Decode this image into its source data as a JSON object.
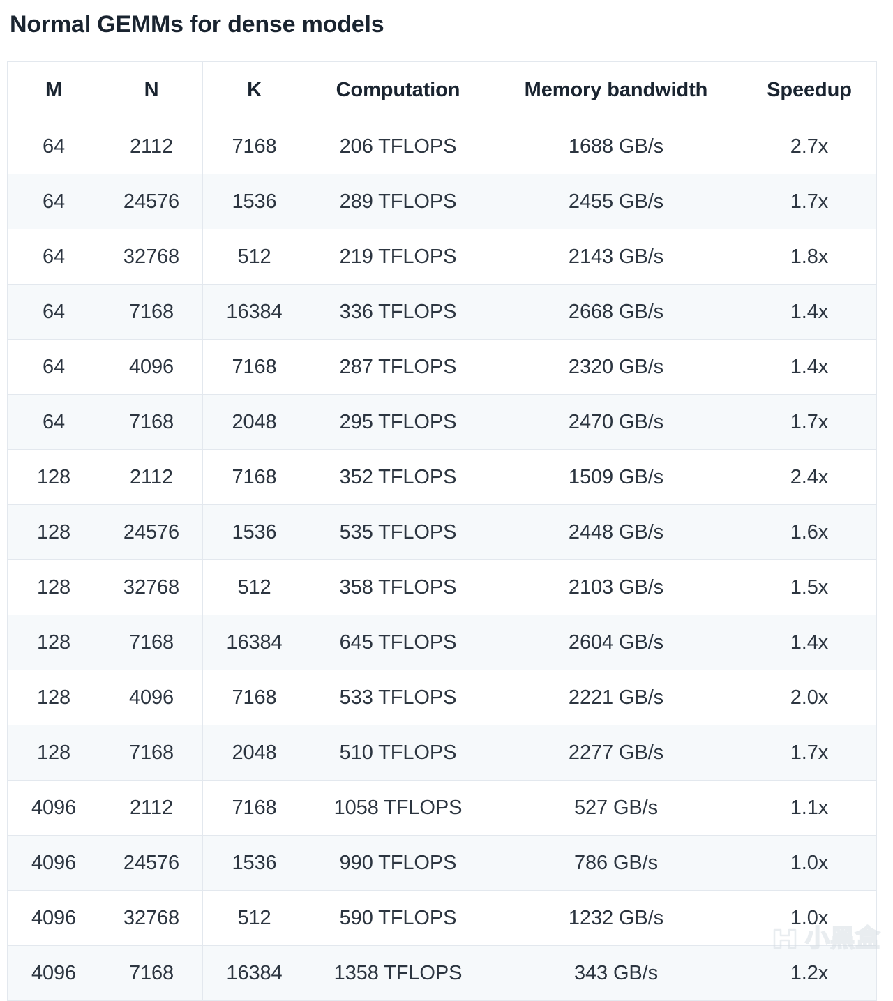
{
  "page": {
    "title": "Normal GEMMs for dense models"
  },
  "table": {
    "columns": [
      {
        "key": "m",
        "label": "M"
      },
      {
        "key": "n",
        "label": "N"
      },
      {
        "key": "k",
        "label": "K"
      },
      {
        "key": "comp",
        "label": "Computation"
      },
      {
        "key": "mem",
        "label": "Memory bandwidth"
      },
      {
        "key": "speedup",
        "label": "Speedup"
      }
    ],
    "rows": [
      {
        "m": "64",
        "n": "2112",
        "k": "7168",
        "comp": "206 TFLOPS",
        "mem": "1688 GB/s",
        "speedup": "2.7x"
      },
      {
        "m": "64",
        "n": "24576",
        "k": "1536",
        "comp": "289 TFLOPS",
        "mem": "2455 GB/s",
        "speedup": "1.7x"
      },
      {
        "m": "64",
        "n": "32768",
        "k": "512",
        "comp": "219 TFLOPS",
        "mem": "2143 GB/s",
        "speedup": "1.8x"
      },
      {
        "m": "64",
        "n": "7168",
        "k": "16384",
        "comp": "336 TFLOPS",
        "mem": "2668 GB/s",
        "speedup": "1.4x"
      },
      {
        "m": "64",
        "n": "4096",
        "k": "7168",
        "comp": "287 TFLOPS",
        "mem": "2320 GB/s",
        "speedup": "1.4x"
      },
      {
        "m": "64",
        "n": "7168",
        "k": "2048",
        "comp": "295 TFLOPS",
        "mem": "2470 GB/s",
        "speedup": "1.7x"
      },
      {
        "m": "128",
        "n": "2112",
        "k": "7168",
        "comp": "352 TFLOPS",
        "mem": "1509 GB/s",
        "speedup": "2.4x"
      },
      {
        "m": "128",
        "n": "24576",
        "k": "1536",
        "comp": "535 TFLOPS",
        "mem": "2448 GB/s",
        "speedup": "1.6x"
      },
      {
        "m": "128",
        "n": "32768",
        "k": "512",
        "comp": "358 TFLOPS",
        "mem": "2103 GB/s",
        "speedup": "1.5x"
      },
      {
        "m": "128",
        "n": "7168",
        "k": "16384",
        "comp": "645 TFLOPS",
        "mem": "2604 GB/s",
        "speedup": "1.4x"
      },
      {
        "m": "128",
        "n": "4096",
        "k": "7168",
        "comp": "533 TFLOPS",
        "mem": "2221 GB/s",
        "speedup": "2.0x"
      },
      {
        "m": "128",
        "n": "7168",
        "k": "2048",
        "comp": "510 TFLOPS",
        "mem": "2277 GB/s",
        "speedup": "1.7x"
      },
      {
        "m": "4096",
        "n": "2112",
        "k": "7168",
        "comp": "1058 TFLOPS",
        "mem": "527 GB/s",
        "speedup": "1.1x"
      },
      {
        "m": "4096",
        "n": "24576",
        "k": "1536",
        "comp": "990 TFLOPS",
        "mem": "786 GB/s",
        "speedup": "1.0x"
      },
      {
        "m": "4096",
        "n": "32768",
        "k": "512",
        "comp": "590 TFLOPS",
        "mem": "1232 GB/s",
        "speedup": "1.0x"
      },
      {
        "m": "4096",
        "n": "7168",
        "k": "16384",
        "comp": "1358 TFLOPS",
        "mem": "343 GB/s",
        "speedup": "1.2x"
      }
    ]
  },
  "watermark": {
    "text": "小黑盒",
    "logo_icon": "xiaoheihe-logo-icon"
  },
  "colors": {
    "title_text": "#1a2430",
    "body_text": "#2c3540",
    "border": "#e3e8ee",
    "row_stripe": "#f6f9fb",
    "background": "#ffffff"
  }
}
